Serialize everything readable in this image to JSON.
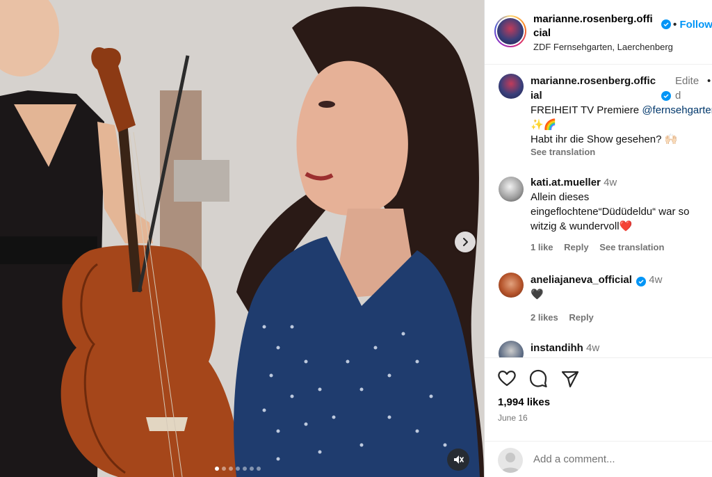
{
  "post": {
    "username": "marianne.rosenberg.official",
    "username_line1": "marianne.rosenberg.offi",
    "username_line2": "cial",
    "separator": "•",
    "follow_label": "Follow",
    "location": "ZDF Fernsehgarten, Laerchenberg"
  },
  "caption": {
    "username_line1": "marianne.rosenberg.offic",
    "username_line2": "ial",
    "edited_line1": "Edite",
    "edited_line2": "d",
    "more": "•",
    "text_line1": "FREIHEIT TV Premiere ",
    "mention": "@fernsehgarten",
    "text_line2": "✨🌈",
    "text_line3": "Habt ihr die Show gesehen? 🙌🏻",
    "see_translation": "See translation"
  },
  "comments": [
    {
      "username": "kati.at.mueller",
      "time": "4w",
      "text": "Allein dieses eingeflochtene“Düdüdeldu“ war so witzig & wundervoll❤️",
      "likes": "1 like",
      "reply": "Reply",
      "see_translation": "See translation"
    },
    {
      "username": "aneliajaneva_official",
      "time": "4w",
      "text": "🖤",
      "likes": "2 likes",
      "reply": "Reply"
    },
    {
      "username": "instandihh",
      "time": "4w"
    }
  ],
  "actions": {
    "likes": "1,994 likes",
    "date": "June 16",
    "icons": [
      "heart-icon",
      "comment-icon",
      "share-icon"
    ]
  },
  "add_comment": {
    "placeholder": "Add a comment..."
  },
  "media": {
    "carousel_count": 7,
    "carousel_active": 1
  },
  "colors": {
    "accent": "#0095f6",
    "muted": "#737373",
    "mention": "#00376b"
  }
}
